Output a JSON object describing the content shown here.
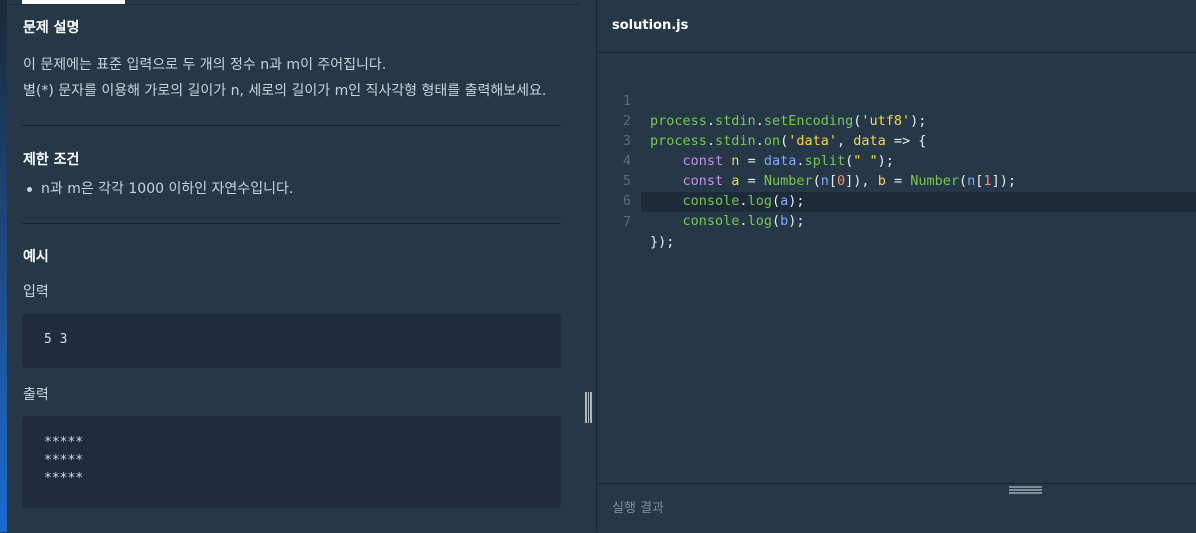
{
  "problem": {
    "description_title": "문제 설명",
    "description_lines": [
      "이 문제에는 표준 입력으로 두 개의 정수 n과 m이 주어집니다.",
      "별(*) 문자를 이용해 가로의 길이가 n, 세로의 길이가 m인 직사각형 형태를 출력해보세요."
    ],
    "constraints_title": "제한 조건",
    "constraints": [
      "n과 m은 각각 1000 이하인 자연수입니다."
    ],
    "example_title": "예시",
    "input_label": "입력",
    "input_value": "5 3",
    "output_label": "출력",
    "output_value": "*****\n*****\n*****"
  },
  "editor": {
    "file_name": "solution.js",
    "line_numbers": [
      "1",
      "2",
      "3",
      "4",
      "5",
      "6",
      "7"
    ],
    "active_line": 7,
    "code_lines": [
      "process.stdin.setEncoding('utf8');",
      "process.stdin.on('data', data => {",
      "    const n = data.split(\" \");",
      "    const a = Number(n[0]), b = Number(n[1]);",
      "    console.log(a);",
      "    console.log(b);",
      "});"
    ]
  },
  "result": {
    "label": "실행 결과"
  },
  "colors": {
    "background": "#263747",
    "code_box": "#202b3d",
    "keyword": "#c792ea",
    "function": "#78c84f",
    "string": "#f5d84a"
  }
}
